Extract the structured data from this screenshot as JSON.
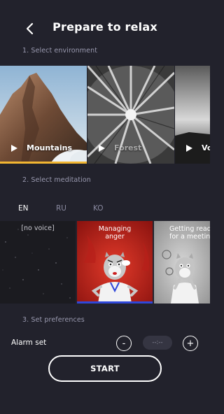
{
  "header": {
    "title": "Prepare to relax",
    "back_icon": "chevron-left-icon"
  },
  "sections": {
    "environment": "1. Select environment",
    "meditation": "2. Select meditation",
    "preferences": "3. Set preferences"
  },
  "environments": [
    {
      "label": "Mountains",
      "selected": true
    },
    {
      "label": "Forest",
      "selected": false
    },
    {
      "label": "Vo",
      "selected": false
    }
  ],
  "languages": [
    {
      "label": "EN",
      "active": true
    },
    {
      "label": "RU",
      "active": false
    },
    {
      "label": "KO",
      "active": false
    }
  ],
  "meditations": [
    {
      "label": "[no voice]"
    },
    {
      "label": "Managing\nanger",
      "selected": true
    },
    {
      "label": "Getting read\nfor a meetin"
    }
  ],
  "preferences": {
    "alarm_label": "Alarm set",
    "minus": "-",
    "time_placeholder": "--:--",
    "plus": "+"
  },
  "start_button": "START",
  "colors": {
    "background": "#22222c",
    "selected_env_bar": "#f2b632",
    "selected_med_bar": "#2f47d9"
  }
}
